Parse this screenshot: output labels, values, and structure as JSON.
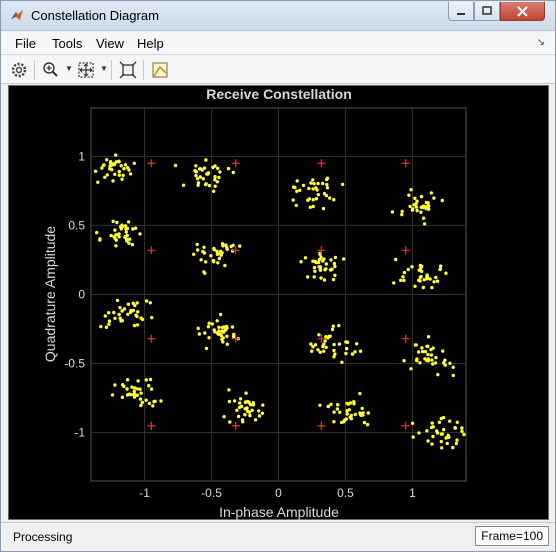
{
  "window": {
    "title": "Constellation Diagram"
  },
  "menu": {
    "items": [
      "File",
      "Tools",
      "View",
      "Help"
    ]
  },
  "toolbar": {
    "tools": [
      "gear-icon",
      "zoom-in-icon",
      "pan-icon",
      "autoscale-icon",
      "measurements-icon"
    ]
  },
  "chart_data": {
    "type": "scatter",
    "title": "Receive Constellation",
    "xlabel": "In-phase Amplitude",
    "ylabel": "Quadrature Amplitude",
    "xlim": [
      -1.4,
      1.4
    ],
    "ylim": [
      -1.35,
      1.35
    ],
    "xticks": [
      -1,
      -0.5,
      0,
      0.5,
      1
    ],
    "xtick_labels": [
      "-1",
      "-0.5",
      "0",
      "0.5",
      "1"
    ],
    "yticks": [
      1,
      0.5,
      0,
      -0.5,
      -1
    ],
    "ytick_labels": [
      "1",
      "0.5",
      "0",
      "-0.5",
      "-1"
    ],
    "grid": true,
    "series": [
      {
        "kind": "received",
        "color": "#ffff33",
        "cluster_centers": [
          [
            -1.22,
            0.91
          ],
          [
            -0.55,
            0.86
          ],
          [
            0.28,
            0.76
          ],
          [
            1.04,
            0.65
          ],
          [
            -1.17,
            0.41
          ],
          [
            -0.45,
            0.29
          ],
          [
            0.33,
            0.22
          ],
          [
            1.08,
            0.13
          ],
          [
            -1.14,
            -0.15
          ],
          [
            -0.43,
            -0.28
          ],
          [
            0.4,
            -0.35
          ],
          [
            1.15,
            -0.45
          ],
          [
            -1.07,
            -0.7
          ],
          [
            -0.27,
            -0.81
          ],
          [
            0.53,
            -0.85
          ],
          [
            1.22,
            -1.0
          ]
        ]
      },
      {
        "kind": "reference",
        "color": "#ff2a2a",
        "points": [
          [
            -0.95,
            0.95
          ],
          [
            -0.32,
            0.95
          ],
          [
            0.32,
            0.95
          ],
          [
            0.95,
            0.95
          ],
          [
            -0.95,
            0.32
          ],
          [
            -0.32,
            0.32
          ],
          [
            0.32,
            0.32
          ],
          [
            0.95,
            0.32
          ],
          [
            -0.95,
            -0.32
          ],
          [
            -0.32,
            -0.32
          ],
          [
            0.32,
            -0.32
          ],
          [
            0.95,
            -0.32
          ],
          [
            -0.95,
            -0.95
          ],
          [
            -0.32,
            -0.95
          ],
          [
            0.32,
            -0.95
          ],
          [
            0.95,
            -0.95
          ]
        ]
      }
    ]
  },
  "status": {
    "text": "Processing",
    "frame": "Frame=100"
  }
}
